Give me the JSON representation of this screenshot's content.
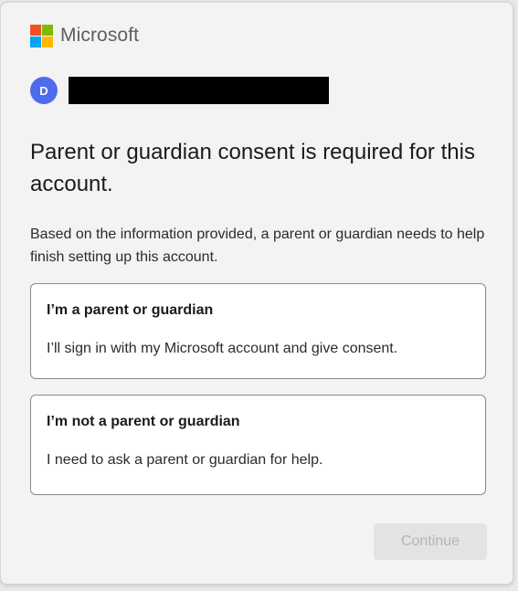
{
  "brand": {
    "name": "Microsoft",
    "logo_colors": [
      "#f25022",
      "#7fba00",
      "#00a4ef",
      "#ffb900"
    ]
  },
  "account": {
    "avatar_initial": "D",
    "avatar_color": "#4f6bed",
    "email_redacted": true
  },
  "heading": "Parent or guardian consent is required for this account.",
  "description": "Based on the information provided, a parent or guardian needs to help finish setting up this account.",
  "options": [
    {
      "title": "I’m a parent or guardian",
      "description": "I’ll sign in with my Microsoft account and give consent."
    },
    {
      "title": "I’m not a parent or guardian",
      "description": "I need to ask a parent or guardian for help."
    }
  ],
  "continue_button": {
    "label": "Continue",
    "state": "disabled"
  }
}
